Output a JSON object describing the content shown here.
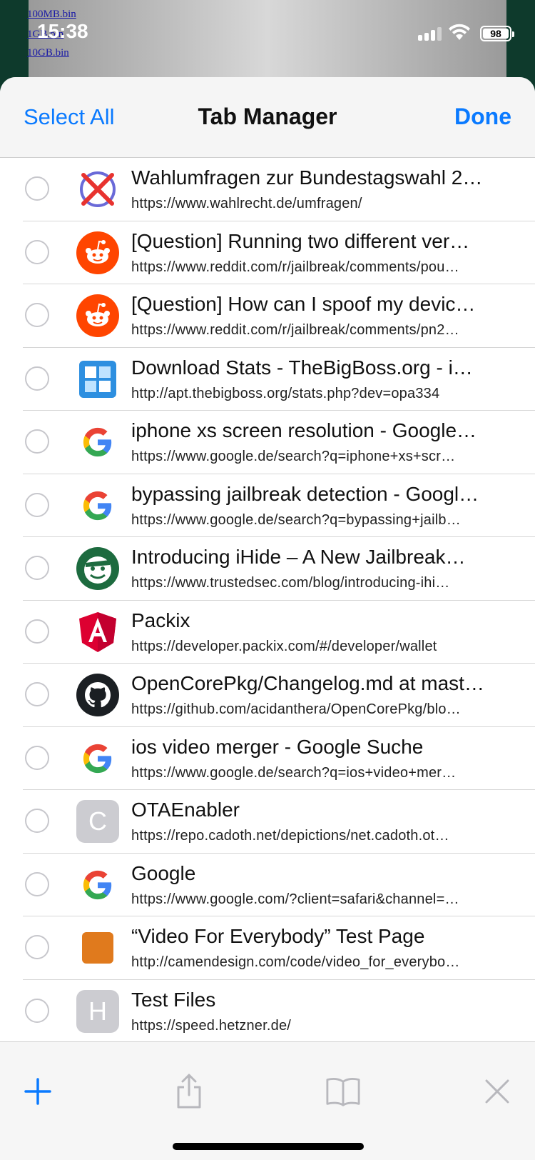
{
  "status_bar": {
    "time": "15:38",
    "battery": "98"
  },
  "background_page": {
    "links": [
      "100MB.bin",
      "1GB.bin",
      "10GB.bin"
    ]
  },
  "nav": {
    "select_all": "Select All",
    "title": "Tab Manager",
    "done": "Done"
  },
  "tabs": [
    {
      "title": "Wahlumfragen zur Bundestagswahl 2…",
      "url": "https://www.wahlrecht.de/umfragen/",
      "icon": "wahlrecht-icon"
    },
    {
      "title": "[Question] Running two different ver…",
      "url": "https://www.reddit.com/r/jailbreak/comments/pou…",
      "icon": "reddit-icon"
    },
    {
      "title": "[Question] How can I spoof my devic…",
      "url": "https://www.reddit.com/r/jailbreak/comments/pn2…",
      "icon": "reddit-icon"
    },
    {
      "title": "Download Stats - TheBigBoss.org - i…",
      "url": "http://apt.thebigboss.org/stats.php?dev=opa334",
      "icon": "bigboss-icon"
    },
    {
      "title": "iphone xs screen resolution - Google…",
      "url": "https://www.google.de/search?q=iphone+xs+scr…",
      "icon": "google-icon"
    },
    {
      "title": "bypassing jailbreak detection - Googl…",
      "url": "https://www.google.de/search?q=bypassing+jailb…",
      "icon": "google-icon"
    },
    {
      "title": "Introducing iHide – A New Jailbreak…",
      "url": "https://www.trustedsec.com/blog/introducing-ihi…",
      "icon": "trustedsec-icon"
    },
    {
      "title": "Packix",
      "url": "https://developer.packix.com/#/developer/wallet",
      "icon": "angular-icon"
    },
    {
      "title": "OpenCorePkg/Changelog.md at mast…",
      "url": "https://github.com/acidanthera/OpenCorePkg/blo…",
      "icon": "github-icon"
    },
    {
      "title": "ios video merger - Google Suche",
      "url": "https://www.google.de/search?q=ios+video+mer…",
      "icon": "google-icon"
    },
    {
      "title": "OTAEnabler",
      "url": "https://repo.cadoth.net/depictions/net.cadoth.ot…",
      "icon": "letter-c-icon",
      "letter": "C"
    },
    {
      "title": "Google",
      "url": "https://www.google.com/?client=safari&channel=…",
      "icon": "google-icon"
    },
    {
      "title": "“Video For Everybody” Test Page",
      "url": "http://camendesign.com/code/video_for_everybo…",
      "icon": "camendesign-icon"
    },
    {
      "title": "Test Files",
      "url": "https://speed.hetzner.de/",
      "icon": "letter-h-icon",
      "letter": "H"
    }
  ],
  "toolbar": [
    "plus-icon",
    "share-icon",
    "bookmarks-icon",
    "close-icon"
  ],
  "colors": {
    "accent": "#0a7aff",
    "reddit": "#ff4500",
    "separator": "#d6d6d6"
  }
}
